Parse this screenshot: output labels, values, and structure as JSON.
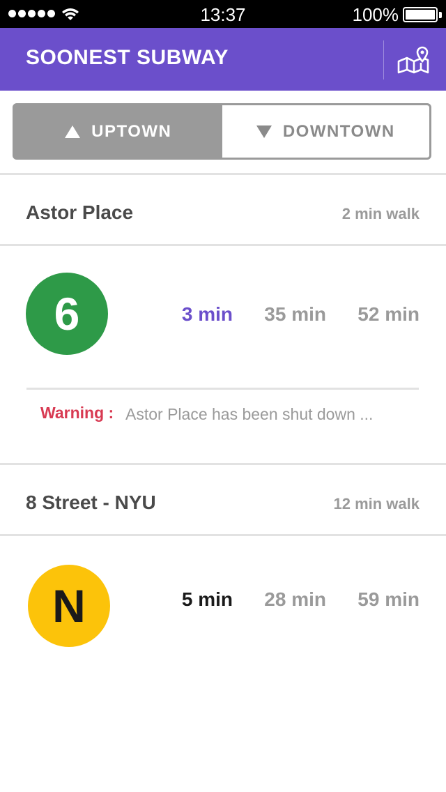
{
  "status_bar": {
    "time": "13:37",
    "battery": "100%"
  },
  "header": {
    "title": "SOONEST SUBWAY",
    "map_icon": "map-pin-icon"
  },
  "direction": {
    "uptown_label": "UPTOWN",
    "downtown_label": "DOWNTOWN",
    "selected": "uptown"
  },
  "stations": [
    {
      "name": "Astor Place",
      "walk": "2 min walk",
      "line": "6",
      "line_color": "#2e9a48",
      "times": [
        "3 min",
        "35 min",
        "52 min"
      ],
      "first_time_color": "#6b4fcb",
      "warning_label": "Warning :",
      "warning_text": "Astor Place has been shut down ..."
    },
    {
      "name": "8 Street  -  NYU",
      "walk": "12 min walk",
      "line": "N",
      "line_color": "#fcc30a",
      "times": [
        "5 min",
        "28 min",
        "59 min"
      ],
      "first_time_color": "#1a1a1a"
    }
  ],
  "colors": {
    "accent": "#6b4fcb",
    "warning": "#d83a52",
    "muted": "#9a9a9a"
  }
}
